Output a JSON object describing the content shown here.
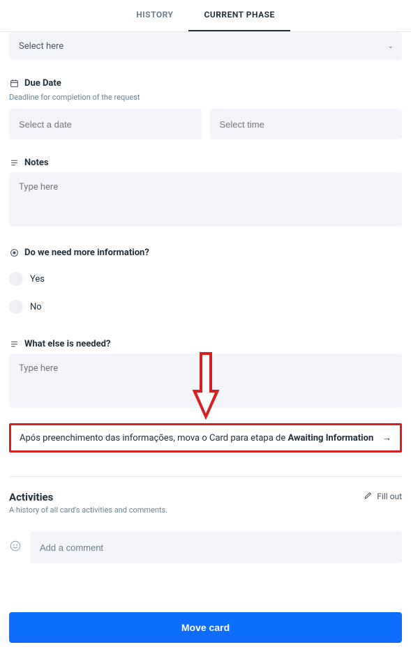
{
  "tabs": {
    "history": "HISTORY",
    "current": "CURRENT PHASE"
  },
  "select": {
    "placeholder": "Select here"
  },
  "due": {
    "label": "Due Date",
    "desc": "Deadline for completion of the request",
    "date_ph": "Select a date",
    "time_ph": "Select time"
  },
  "notes": {
    "label": "Notes",
    "ph": "Type here"
  },
  "moreinfo": {
    "label": "Do we need more information?",
    "opt_yes": "Yes",
    "opt_no": "No"
  },
  "whatelse": {
    "label": "What else is needed?",
    "ph": "Type here"
  },
  "callout": {
    "prefix": "Após preenchimento das informações, mova o Card para etapa de ",
    "bold": "Awaiting Information"
  },
  "activities": {
    "title": "Activities",
    "sub": "A history of all card's activities and comments.",
    "fill_out": "Fill out",
    "comment_ph": "Add a comment"
  },
  "move": {
    "label": "Move card"
  }
}
